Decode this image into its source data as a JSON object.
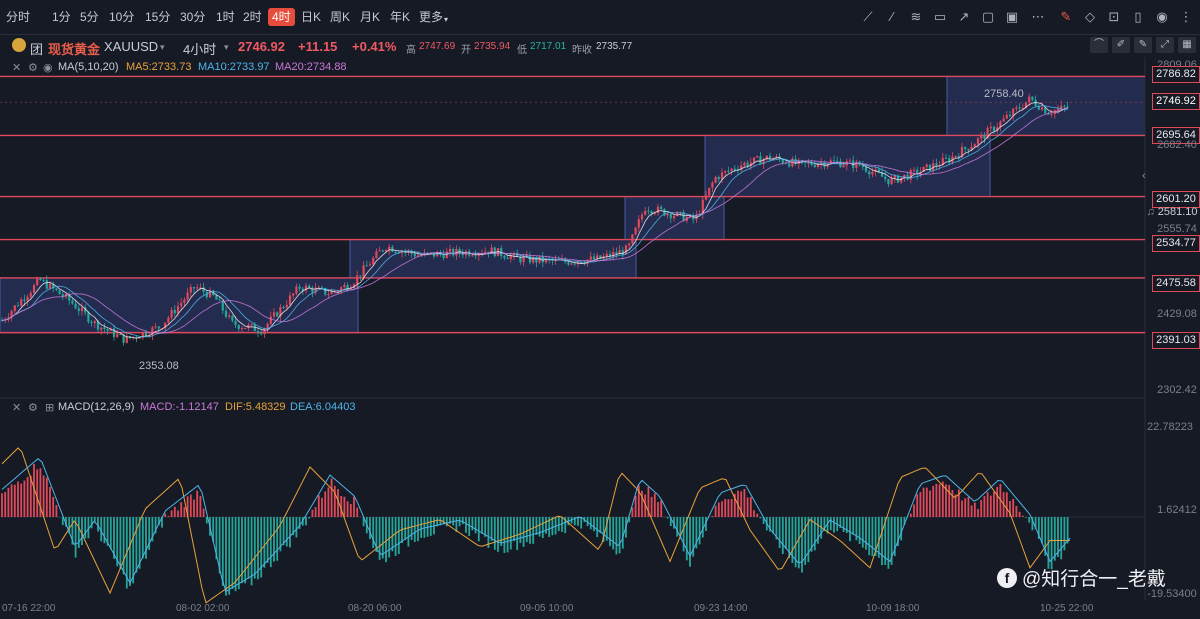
{
  "toolbar": {
    "intervals": [
      "分时",
      "1分",
      "5分",
      "10分",
      "15分",
      "30分",
      "1时",
      "2时",
      "4时",
      "日K",
      "周K",
      "月K",
      "年K",
      "更多"
    ],
    "active_interval": "4时",
    "tools": [
      "pen-icon",
      "line-tool-icon",
      "draw-tool-icon",
      "rectangle-icon",
      "arrow-icon",
      "comment-icon",
      "image-icon",
      "more-icon",
      "edit-icon",
      "eraser-icon",
      "lock-icon",
      "trash-icon",
      "eye-icon"
    ]
  },
  "symbol": {
    "name": "现货黄金",
    "code": "XAUUSD",
    "badge": "团",
    "interval": "4小时",
    "price": "2746.92",
    "change": "+11.15",
    "change_pct": "+0.41%",
    "high_label": "高",
    "high": "2747.69",
    "open_label": "开",
    "open": "2735.94",
    "low_label": "低",
    "low": "2717.01",
    "prev_label": "昨收",
    "prev": "2735.77"
  },
  "ma": {
    "title": "MA(5,10,20)",
    "ma5": "MA5:2733.73",
    "ma10": "MA10:2733.97",
    "ma20": "MA20:2734.88"
  },
  "macd": {
    "title": "MACD(12,26,9)",
    "macd": "MACD:-1.12147",
    "dif": "DIF:5.48329",
    "dea": "DEA:6.04403",
    "axis_top": "22.78223",
    "axis_mid": "1.62412",
    "axis_bottom": "-19.53400"
  },
  "price_levels": {
    "red": [
      "2786.82",
      "2746.92",
      "2695.64",
      "2601.20",
      "2534.77",
      "2475.58",
      "2391.03"
    ],
    "grey": [
      "2809.06",
      "2682.40",
      "2555.74",
      "2429.08",
      "2302.42"
    ],
    "bell_price": "2581.10"
  },
  "annotations": {
    "high_mark": "2758.40",
    "low_mark": "2353.08"
  },
  "x_axis": [
    "07-16 22:00",
    "08-02 02:00",
    "08-20 06:00",
    "09-05 10:00",
    "09-23 14:00",
    "10-09 18:00",
    "10-25 22:00"
  ],
  "watermark": "@知行合一_老戴",
  "colors": {
    "up": "#e0495a",
    "down": "#26a69a",
    "ma5": "#e8e8ee",
    "ma10": "#4fb4e8",
    "ma20": "#e8a23a",
    "box": "#2b3566",
    "level": "#e0495a"
  }
}
